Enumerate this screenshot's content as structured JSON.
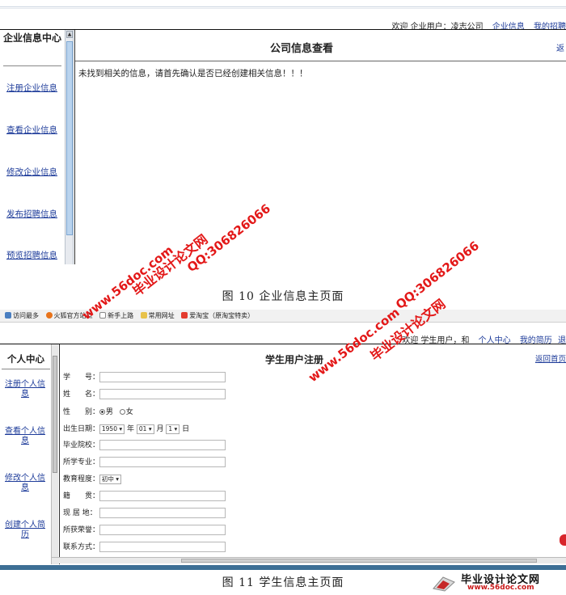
{
  "figure10": {
    "topbar": {
      "welcome": "欢迎",
      "user_label": "企业用户：",
      "user_name": "凌志公司",
      "link1": "企业信息",
      "link2": "我的招聘"
    },
    "sidebar": {
      "title": "企业信息中心",
      "items": [
        {
          "label": "注册企业信息"
        },
        {
          "label": "查看企业信息"
        },
        {
          "label": "修改企业信息"
        },
        {
          "label": "发布招聘信息"
        },
        {
          "label": "预览招聘信息"
        }
      ]
    },
    "main": {
      "title": "公司信息查看",
      "corner_link": "返",
      "message": "未找到相关的信息，请首先确认是否已经创建相关信息！！！"
    },
    "caption": "图 10 企业信息主页面"
  },
  "figure11": {
    "favorites": [
      {
        "label": "访问最多",
        "icon": "bookmark-icon",
        "color": "#4a7fc1"
      },
      {
        "label": "火狐官方站点",
        "icon": "firefox-icon",
        "color": "#e8731a"
      },
      {
        "label": "新手上路",
        "icon": "page-icon",
        "color": "#ffffff"
      },
      {
        "label": "常用网址",
        "icon": "folder-icon",
        "color": "#e8c24a"
      },
      {
        "label": "爱淘宝（原淘宝特卖）",
        "icon": "taobao-icon",
        "color": "#e33b2e"
      }
    ],
    "topbar": {
      "welcome": "欢迎",
      "user_label": "学生用户，",
      "user_name": "和",
      "link1": "个人中心",
      "link2": "我的简历",
      "link3": "退"
    },
    "sidebar": {
      "title": "个人中心",
      "items": [
        {
          "line1": "注册个人信",
          "line2": "息"
        },
        {
          "line1": "查看个人信",
          "line2": "息"
        },
        {
          "line1": "修改个人信",
          "line2": "息"
        },
        {
          "line1": "创建个人简",
          "line2": "历"
        }
      ]
    },
    "main": {
      "title": "学生用户注册",
      "corner_link": "返回首页",
      "form": {
        "student_id_label": "学　　号：",
        "name_label": "姓　　名：",
        "gender_label": "性　　别：",
        "gender_male": "男",
        "gender_female": "女",
        "birth_label": "出生日期：",
        "birth_year": "1950",
        "year_unit": "年",
        "birth_month": "01",
        "month_unit": "月",
        "birth_day": "1",
        "day_unit": "日",
        "school_label": "毕业院校：",
        "major_label": "所学专业：",
        "education_label": "教育程度：",
        "education_value": "初中",
        "native_label": "籍　　贯：",
        "residence_label": "现 居 地：",
        "honors_label": "所获荣誉：",
        "contact_label": "联系方式："
      }
    },
    "caption": "图 11 学生信息主页面"
  },
  "watermarks": {
    "site_cn": "毕业设计论文网",
    "site_url": "www.56doc.com",
    "qq": "QQ:306826066"
  },
  "logo": {
    "cn": "毕业设计论文网",
    "url": "www.56doc.com"
  }
}
